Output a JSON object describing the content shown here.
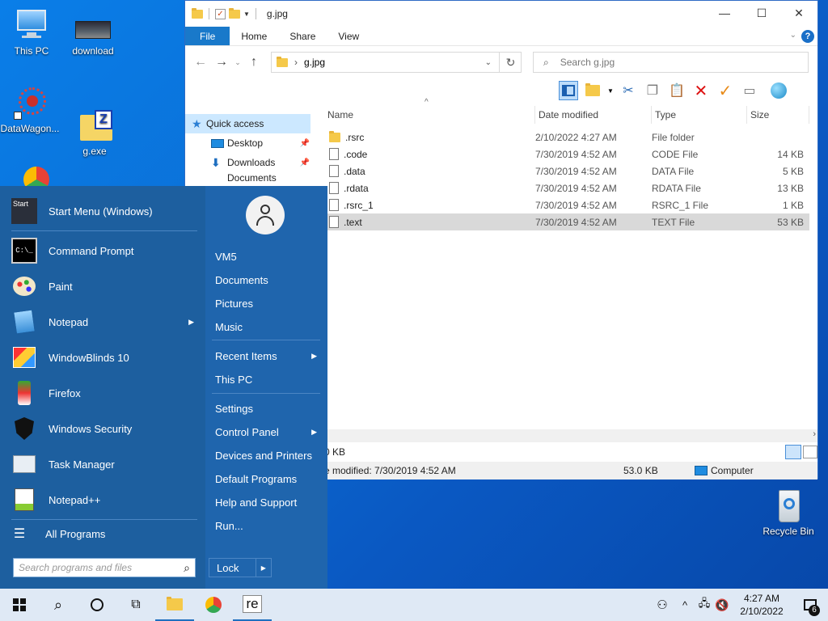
{
  "desktop": {
    "icons": [
      "This PC",
      "download",
      "DataWagon...",
      "g.exe",
      "Recycle Bin"
    ]
  },
  "explorer": {
    "title": "g.jpg",
    "tabs": [
      "File",
      "Home",
      "Share",
      "View"
    ],
    "address": "g.jpg",
    "search_placeholder": "Search g.jpg",
    "nav": [
      {
        "label": "Quick access"
      },
      {
        "label": "Desktop"
      },
      {
        "label": "Downloads"
      },
      {
        "label": "Documents"
      }
    ],
    "columns": [
      "Name",
      "Date modified",
      "Type",
      "Size"
    ],
    "files": [
      {
        "name": ".rsrc",
        "date": "2/10/2022 4:27 AM",
        "type": "File folder",
        "size": ""
      },
      {
        "name": ".code",
        "date": "7/30/2019 4:52 AM",
        "type": "CODE File",
        "size": "14 KB"
      },
      {
        "name": ".data",
        "date": "7/30/2019 4:52 AM",
        "type": "DATA File",
        "size": "5 KB"
      },
      {
        "name": ".rdata",
        "date": "7/30/2019 4:52 AM",
        "type": "RDATA File",
        "size": "13 KB"
      },
      {
        "name": ".rsrc_1",
        "date": "7/30/2019 4:52 AM",
        "type": "RSRC_1 File",
        "size": "1 KB"
      },
      {
        "name": ".text",
        "date": "7/30/2019 4:52 AM",
        "type": "TEXT File",
        "size": "53 KB"
      }
    ],
    "status_partial": "0 KB",
    "details_modified": "e modified: 7/30/2019 4:52 AM",
    "details_size": "53.0 KB",
    "details_location": "Computer"
  },
  "startmenu": {
    "left_items": [
      "Start Menu (Windows)",
      "Command Prompt",
      "Paint",
      "Notepad",
      "WindowBlinds 10",
      "Firefox",
      "Windows Security",
      "Task Manager",
      "Notepad++"
    ],
    "all_programs": "All Programs",
    "search_placeholder": "Search programs and files",
    "right_items": [
      "VM5",
      "Documents",
      "Pictures",
      "Music",
      "Recent Items",
      "This PC",
      "Settings",
      "Control Panel",
      "Devices and Printers",
      "Default Programs",
      "Help and Support",
      "Run..."
    ],
    "lock": "Lock",
    "start_icon_text": "Start"
  },
  "taskbar": {
    "time": "4:27 AM",
    "date": "2/10/2022",
    "notif_count": "6",
    "app_label": "re"
  }
}
